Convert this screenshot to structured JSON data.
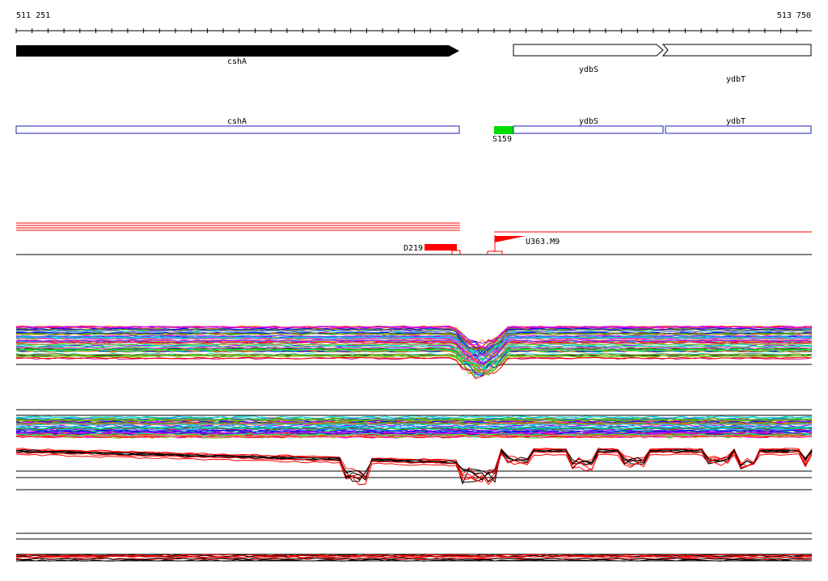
{
  "coords": {
    "start": "511 251",
    "end": "513 750"
  },
  "genes": {
    "cshA": "cshA",
    "ydbS": "ydbS",
    "ydbT": "ydbT"
  },
  "features": {
    "promoter_label": "S159",
    "terminator_label": "D219",
    "transcript_label": "U363.M9"
  },
  "colors": {
    "gene_fill": "#000000",
    "gene_outline": "#000000",
    "operon_box": "#1f1fb0",
    "promoter": "#00dd00",
    "signal": "#ff0000",
    "axis": "#000000",
    "palette": [
      "#ff0000",
      "#00aa00",
      "#0000ff",
      "#ff00ff",
      "#00cccc",
      "#ff8800",
      "#8800ff",
      "#888800",
      "#00ff66",
      "#ff6699",
      "#3366ff",
      "#996633",
      "#66cc00",
      "#cc0066",
      "#00ccff"
    ]
  }
}
